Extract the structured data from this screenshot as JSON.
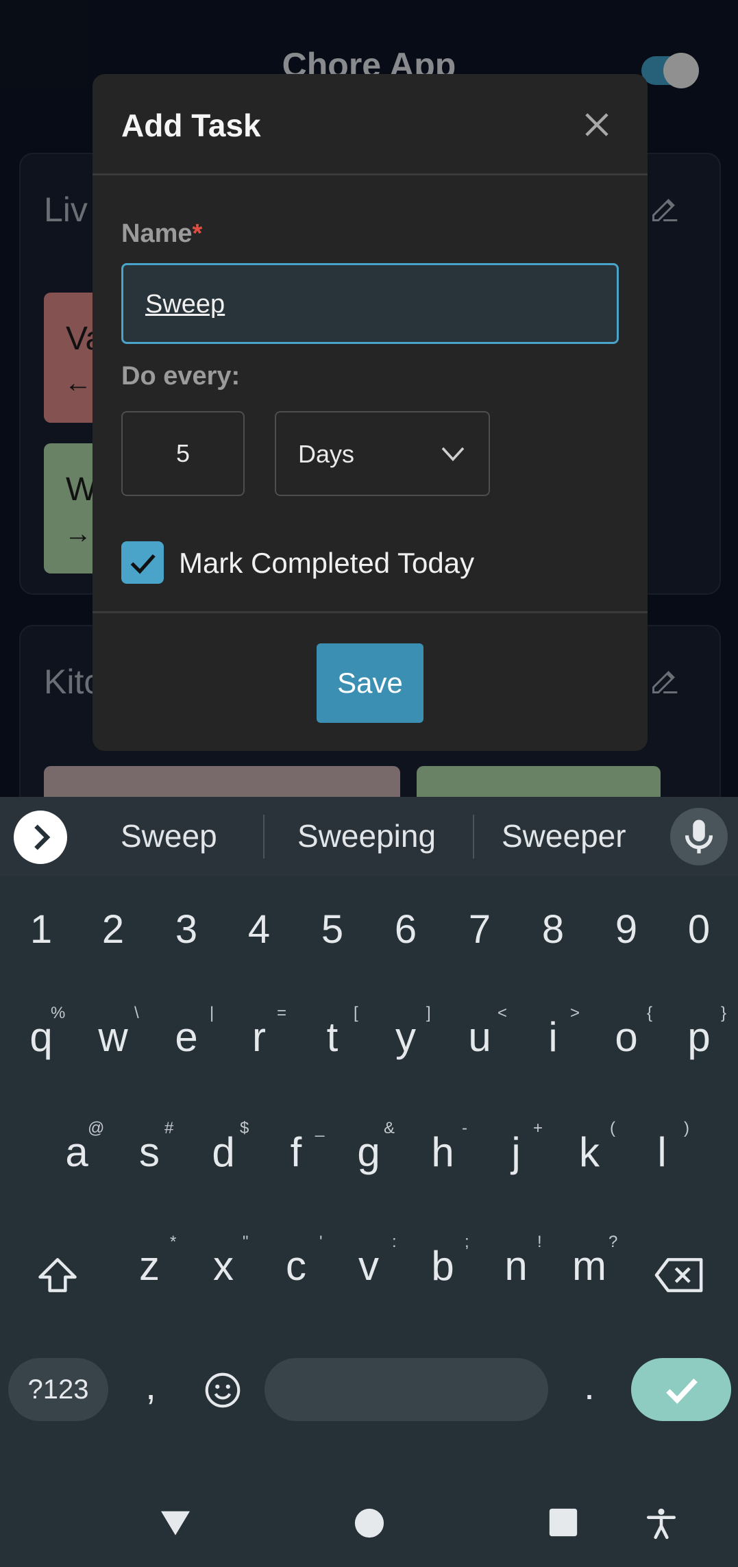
{
  "app": {
    "title": "Chore App",
    "accent_color": "#3a8fb3"
  },
  "rooms": [
    {
      "title": "Liv",
      "chores": [
        {
          "name": "Va",
          "arrow": "←",
          "color": "#c47a79"
        },
        {
          "name": "W",
          "arrow": "→",
          "color": "#9bbf96"
        }
      ]
    },
    {
      "title": "Kitc",
      "chores": [
        {
          "color": "#b29c9c"
        },
        {
          "color": "#9bbf96"
        }
      ]
    }
  ],
  "dialog": {
    "title": "Add Task",
    "close_icon": "close-icon",
    "name_label": "Name",
    "required_mark": "*",
    "name_value": "Sweep",
    "do_every_label": "Do every:",
    "interval_value": "5",
    "interval_unit": "Days",
    "mark_completed_checked": true,
    "mark_completed_label": "Mark Completed Today",
    "save_label": "Save"
  },
  "keyboard": {
    "suggestions": [
      "Sweep",
      "Sweeping",
      "Sweeper"
    ],
    "numbers": [
      "1",
      "2",
      "3",
      "4",
      "5",
      "6",
      "7",
      "8",
      "9",
      "0"
    ],
    "row1": [
      "q",
      "w",
      "e",
      "r",
      "t",
      "y",
      "u",
      "i",
      "o",
      "p"
    ],
    "row1_hints": [
      "%",
      "\\",
      "|",
      "=",
      "[",
      "]",
      "<",
      ">",
      "{",
      "}"
    ],
    "row2": [
      "a",
      "s",
      "d",
      "f",
      "g",
      "h",
      "j",
      "k",
      "l"
    ],
    "row2_hints": [
      "@",
      "#",
      "$",
      "_",
      "&",
      "-",
      "+",
      "(",
      ")"
    ],
    "row3": [
      "z",
      "x",
      "c",
      "v",
      "b",
      "n",
      "m"
    ],
    "row3_hints": [
      "*",
      "\"",
      "'",
      ":",
      ";",
      "!",
      "?"
    ],
    "symbols_label": "?123",
    "comma": ",",
    "period": ".",
    "icons": [
      "chevron-right-icon",
      "mic-icon",
      "shift-icon",
      "backspace-icon",
      "emoji-icon",
      "check-icon"
    ]
  },
  "navbar": {
    "icons": [
      "back-icon",
      "home-icon",
      "recents-icon",
      "accessibility-icon"
    ]
  }
}
